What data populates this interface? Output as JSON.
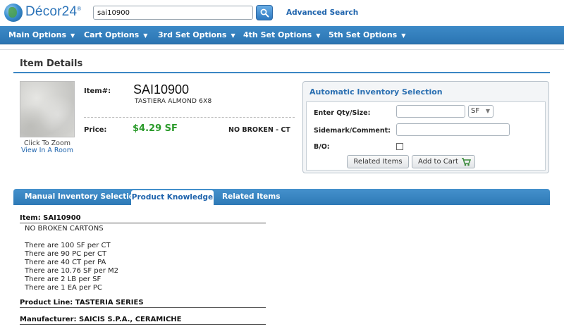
{
  "header": {
    "logo_text": "Décor24",
    "logo_mark": "®",
    "search_value": "sai10900",
    "advanced_search": "Advanced Search"
  },
  "nav": {
    "items": [
      {
        "label": "Main Options"
      },
      {
        "label": "Cart Options"
      },
      {
        "label": "3rd Set Options"
      },
      {
        "label": "4th Set Options"
      },
      {
        "label": "5th Set Options"
      }
    ],
    "caret": "▼"
  },
  "item_details": {
    "title": "Item Details",
    "click_to_zoom": "Click To Zoom",
    "view_in_room": "View In A Room",
    "item_label": "Item#:",
    "item_code": "SAI10900",
    "item_desc": "TASTIERA ALMOND 6X8",
    "price_label": "Price:",
    "price": "$4.29 SF",
    "stock_note": "NO BROKEN - CT"
  },
  "auto_inventory": {
    "title": "Automatic Inventory Selection",
    "qty_label": "Enter Qty/Size:",
    "qty_value": "",
    "unit_value": "SF",
    "sidemark_label": "Sidemark/Comment:",
    "sidemark_value": "",
    "bo_label": "B/O:",
    "related_button": "Related Items",
    "add_cart_button": "Add to Cart"
  },
  "tabs": [
    {
      "label": "Manual Inventory Selection",
      "active": false
    },
    {
      "label": "Product Knowledge",
      "active": true
    },
    {
      "label": "Related Items",
      "active": false
    }
  ],
  "product_knowledge": {
    "item_heading": "Item: SAI10900",
    "note": "NO BROKEN CARTONS",
    "conversions": [
      "There are 100 SF per CT",
      "There are 90 PC per CT",
      "There are 40 CT per PA",
      "There are 10.76 SF per M2",
      "There are 2 LB per SF",
      "There are 1 EA per PC"
    ],
    "product_line": "Product Line: TASTERIA SERIES",
    "manufacturer": "Manufacturer: SAICIS S.P.A., CERAMICHE"
  },
  "colors": {
    "accent_blue": "#2b75b3",
    "link_blue": "#1f64ad",
    "price_green": "#2a9a2a"
  }
}
